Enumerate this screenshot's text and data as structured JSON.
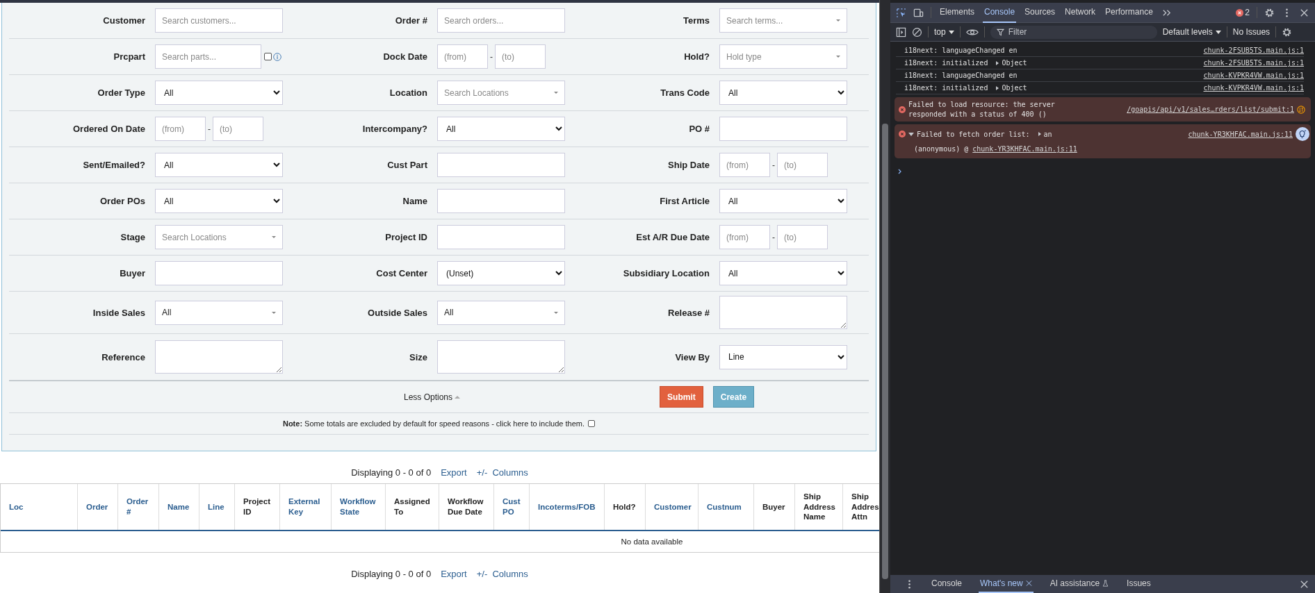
{
  "filters": [
    {
      "label": "Customer",
      "kind": "text",
      "placeholder": "Search customers..."
    },
    {
      "label": "Order #",
      "kind": "text",
      "placeholder": "Search orders..."
    },
    {
      "label": "Terms",
      "kind": "combo",
      "placeholder": "Search terms..."
    },
    {
      "label": "Prcpart",
      "kind": "text-check",
      "placeholder": "Search parts...",
      "checked": false
    },
    {
      "label": "Dock Date",
      "kind": "daterange",
      "start": {
        "placeholder": "(from)"
      },
      "separator": "-",
      "end": {
        "placeholder": "(to)"
      }
    },
    {
      "label": "Hold?",
      "kind": "combo",
      "placeholder": "Hold type"
    },
    {
      "label": "Order Type",
      "kind": "select",
      "value": "All"
    },
    {
      "label": "Location",
      "kind": "combo",
      "placeholder": "Search Locations"
    },
    {
      "label": "Trans Code",
      "kind": "select",
      "value": "All"
    },
    {
      "label": "Ordered On Date",
      "kind": "daterange",
      "start": {
        "placeholder": "(from)"
      },
      "separator": "-",
      "end": {
        "placeholder": "(to)"
      }
    },
    {
      "label": "Intercompany?",
      "kind": "select",
      "value": "All"
    },
    {
      "label": "PO #",
      "kind": "text"
    },
    {
      "label": "Sent/Emailed?",
      "kind": "select",
      "value": "All"
    },
    {
      "label": "Cust Part",
      "kind": "text"
    },
    {
      "label": "Ship Date",
      "kind": "daterange",
      "start": {
        "placeholder": "(from)"
      },
      "separator": "-",
      "end": {
        "placeholder": "(to)"
      }
    },
    {
      "label": "Order POs",
      "kind": "select",
      "value": "All"
    },
    {
      "label": "Name",
      "kind": "text"
    },
    {
      "label": "First Article",
      "kind": "select",
      "value": "All"
    },
    {
      "label": "Stage",
      "kind": "combo",
      "placeholder": "Search Locations"
    },
    {
      "label": "Project ID",
      "kind": "text"
    },
    {
      "label": "Est A/R Due Date",
      "kind": "daterange",
      "start": {
        "placeholder": "(from)"
      },
      "separator": "-",
      "end": {
        "placeholder": "(to)"
      }
    },
    {
      "label": "Buyer",
      "kind": "text"
    },
    {
      "label": "Cost Center",
      "kind": "select",
      "value": "(Unset)"
    },
    {
      "label": "Subsidiary Location",
      "kind": "select",
      "value": "All"
    },
    {
      "label": "Inside Sales",
      "kind": "combo",
      "value": "All"
    },
    {
      "label": "Outside Sales",
      "kind": "combo",
      "value": "All"
    },
    {
      "label": "Release #",
      "kind": "textarea"
    },
    {
      "label": "Reference",
      "kind": "textarea"
    },
    {
      "label": "Size",
      "kind": "textarea"
    },
    {
      "label": "View By",
      "kind": "select",
      "value": "Line"
    }
  ],
  "options_toggle": "Less Options",
  "buttons": [
    {
      "label": "Submit",
      "kind": "primary"
    },
    {
      "label": "Create",
      "kind": "secondary"
    }
  ],
  "note": {
    "text": "**Note:** Some totals are excluded by default for speed reasons - click here to include them.",
    "checked": false
  },
  "pagers": [
    {
      "text": "Displaying 0 - 0 of 0",
      "export": "Export",
      "columns": "+/-  Columns"
    },
    {
      "text": "Displaying 0 - 0 of 0",
      "export": "Export",
      "columns": "+/-  Columns"
    }
  ],
  "table": {
    "columns": [
      {
        "label": "Loc",
        "sortable": true
      },
      {
        "label": "Order",
        "sortable": true
      },
      {
        "label": "Order #",
        "sortable": true
      },
      {
        "label": "Name",
        "sortable": true
      },
      {
        "label": "Line",
        "sortable": true
      },
      {
        "label": "Project ID",
        "sortable": false
      },
      {
        "label": "External Key",
        "sortable": true
      },
      {
        "label": "Workflow State",
        "sortable": true
      },
      {
        "label": "Assigned To",
        "sortable": false
      },
      {
        "label": "Workflow Due Date",
        "sortable": false
      },
      {
        "label": "Cust PO",
        "sortable": true
      },
      {
        "label": "Incoterms/FOB",
        "sortable": true
      },
      {
        "label": "Hold?",
        "sortable": false
      },
      {
        "label": "Customer",
        "sortable": true
      },
      {
        "label": "Custnum",
        "sortable": true
      },
      {
        "label": "Buyer",
        "sortable": false
      },
      {
        "label": "Ship Address Name",
        "sortable": false
      },
      {
        "label": "Ship Addres Attn",
        "sortable": false
      }
    ],
    "empty_message": "No data available"
  },
  "devtools": {
    "tabs": [
      {
        "label": "Elements",
        "selected": false
      },
      {
        "label": "Console",
        "selected": true
      },
      {
        "label": "Sources",
        "selected": false
      },
      {
        "label": "Network",
        "selected": false
      },
      {
        "label": "Performance",
        "selected": false
      }
    ],
    "error_count": "2",
    "context": "top",
    "filter_placeholder": "Filter",
    "levels": "Default levels",
    "issues": "No Issues",
    "messages": [
      {
        "kind": "log",
        "text": "i18next: languageChanged en",
        "source": "chunk-2FSUB5TS.main.js:1"
      },
      {
        "kind": "log",
        "text": "i18next: initialized",
        "object": "Object",
        "source": "chunk-2FSUB5TS.main.js:1"
      },
      {
        "kind": "log",
        "text": "i18next: languageChanged en",
        "source": "chunk-KVPKR4VW.main.js:1"
      },
      {
        "kind": "log",
        "text": "i18next: initialized",
        "object": "Object",
        "source": "chunk-KVPKR4VW.main.js:1"
      },
      {
        "kind": "error",
        "text": "Failed to load resource: the server responded with a status of 400 ()",
        "source": "/goapis/api/v1/sales…rders/list/submit:1"
      },
      {
        "kind": "error",
        "expanded": true,
        "text": "Failed to fetch order list:",
        "object": "an",
        "source": "chunk-YR3KHFAC.main.js:11",
        "stack": "(anonymous) @",
        "stack_link": "chunk-YR3KHFAC.main.js:11"
      }
    ],
    "drawer_tabs": [
      {
        "label": "Console",
        "selected": false
      },
      {
        "label": "What's new",
        "selected": true,
        "closable": true
      },
      {
        "label": "AI assistance",
        "selected": false,
        "beta": true
      },
      {
        "label": "Issues",
        "selected": false
      }
    ]
  }
}
